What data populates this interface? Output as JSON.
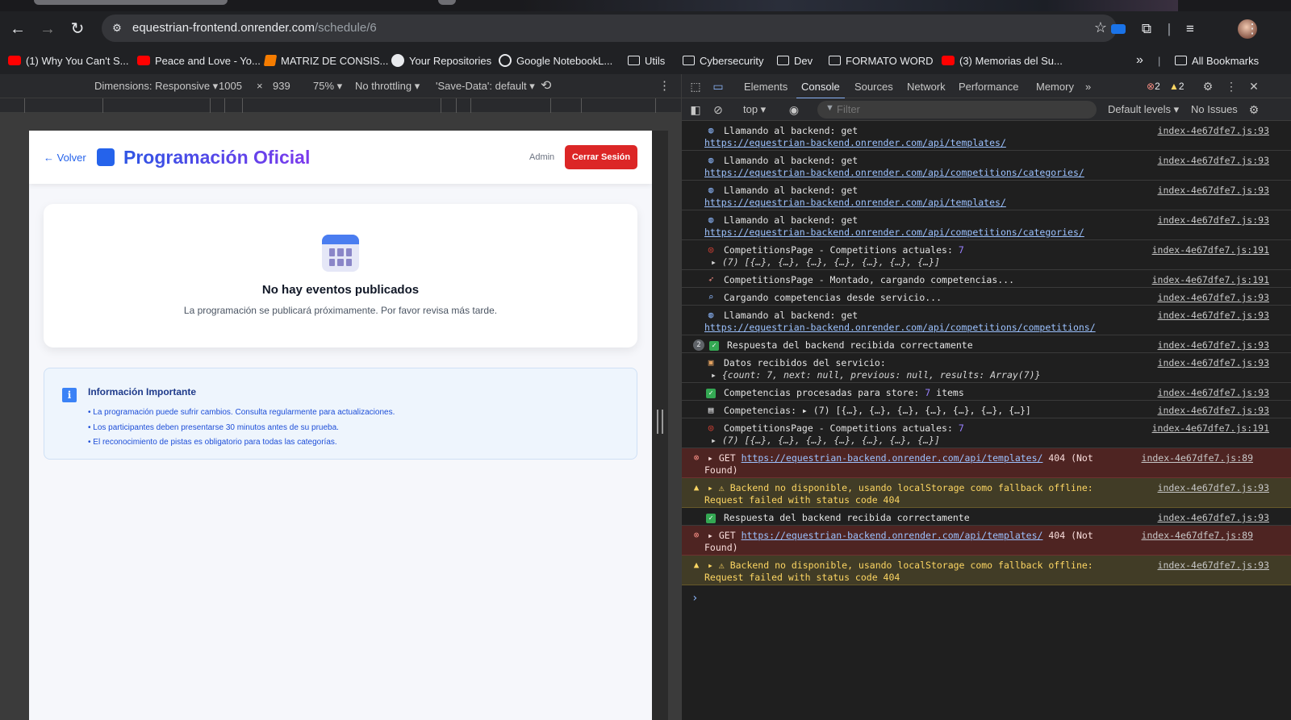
{
  "browser": {
    "url_host": "equestrian-frontend.onrender.com",
    "url_path": "/schedule/6",
    "bookmarks": [
      {
        "label": "(1) Why You Can't S...",
        "icon": "youtube-icon"
      },
      {
        "label": "Peace and Love - Yo...",
        "icon": "youtube-icon"
      },
      {
        "label": "MATRIZ DE CONSIS...",
        "icon": "matrix-icon"
      },
      {
        "label": "Your Repositories",
        "icon": "github-icon"
      },
      {
        "label": "Google NotebookL...",
        "icon": "notebook-icon"
      },
      {
        "label": "Utils",
        "icon": "folder-icon"
      },
      {
        "label": "Cybersecurity",
        "icon": "folder-icon"
      },
      {
        "label": "Dev",
        "icon": "folder-icon"
      },
      {
        "label": "FORMATO WORD",
        "icon": "folder-icon"
      },
      {
        "label": "(3) Memorias del Su...",
        "icon": "youtube-icon"
      }
    ],
    "overflow_label": "»",
    "all_bookmarks": "All Bookmarks"
  },
  "device_toolbar": {
    "dimensions": "Dimensions: Responsive ▾",
    "width": "1005",
    "times": "×",
    "height": "939",
    "zoom": "75% ▾",
    "throttling": "No throttling ▾",
    "save_data": "'Save-Data': default ▾"
  },
  "app": {
    "back": "← Volver",
    "title": "Programación Oficial",
    "user": "Admin",
    "logout": "Cerrar Sesión",
    "empty_title": "No hay eventos publicados",
    "empty_text": "La programación se publicará próximamente. Por favor revisa más tarde.",
    "info_title": "Información Importante",
    "info_items": [
      "• La programación puede sufrir cambios. Consulta regularmente para actualizaciones.",
      "• Los participantes deben presentarse 30 minutos antes de su prueba.",
      "• El reconocimiento de pistas es obligatorio para todas las categorías."
    ]
  },
  "devtools": {
    "tabs": [
      "Elements",
      "Console",
      "Sources",
      "Network",
      "Performance",
      "Memory"
    ],
    "more_tabs": "»",
    "error_count": "2",
    "warning_count": "2",
    "context": "top ▾",
    "filter_placeholder": "Filter",
    "levels": "Default levels ▾",
    "issues": "No Issues",
    "messages": [
      {
        "icon": "globe-icon",
        "text": "Llamando al backend: get",
        "link": "https://equestrian-backend.onrender.com/api/templates/",
        "src": "index-4e67dfe7.js:93"
      },
      {
        "icon": "globe-icon",
        "text": "Llamando al backend: get",
        "link": "https://equestrian-backend.onrender.com/api/competitions/categories/",
        "src": "index-4e67dfe7.js:93"
      },
      {
        "icon": "globe-icon",
        "text": "Llamando al backend: get",
        "link": "https://equestrian-backend.onrender.com/api/templates/",
        "src": "index-4e67dfe7.js:93"
      },
      {
        "icon": "globe-icon",
        "text": "Llamando al backend: get",
        "link": "https://equestrian-backend.onrender.com/api/competitions/categories/",
        "src": "index-4e67dfe7.js:93"
      },
      {
        "icon": "target-icon",
        "text": "CompetitionsPage - Competitions actuales:",
        "num": "7",
        "line2": "▸ (7) [{…}, {…}, {…}, {…}, {…}, {…}, {…}]",
        "src": "index-4e67dfe7.js:191"
      },
      {
        "icon": "rocket-icon",
        "text": "CompetitionsPage - Montado, cargando competencias...",
        "src": "index-4e67dfe7.js:191"
      },
      {
        "icon": "magnifier-icon",
        "text": "Cargando competencias desde servicio...",
        "src": "index-4e67dfe7.js:93"
      },
      {
        "icon": "globe-icon",
        "text": "Llamando al backend: get",
        "link": "https://equestrian-backend.onrender.com/api/competitions/competitions/",
        "src": "index-4e67dfe7.js:93"
      },
      {
        "icon": "check-icon",
        "repeat": "2",
        "text": "Respuesta del backend recibida correctamente",
        "src": "index-4e67dfe7.js:93"
      },
      {
        "icon": "package-icon",
        "text": "Datos recibidos del servicio:",
        "line2": "▸ {count: 7, next: null, previous: null, results: Array(7)}",
        "src": "index-4e67dfe7.js:93"
      },
      {
        "icon": "check-icon",
        "text": "Competencias procesadas para store:",
        "num": "7",
        "tail": "items",
        "src": "index-4e67dfe7.js:93"
      },
      {
        "icon": "clipboard-icon",
        "text": "Competencias:  ▸ (7) [{…}, {…}, {…}, {…}, {…}, {…}, {…}]",
        "src": "index-4e67dfe7.js:93"
      },
      {
        "icon": "target-icon",
        "text": "CompetitionsPage - Competitions actuales:",
        "num": "7",
        "line2": "▸ (7) [{…}, {…}, {…}, {…}, {…}, {…}, {…}]",
        "src": "index-4e67dfe7.js:191"
      },
      {
        "type": "error",
        "icon": "error-icon",
        "prefix": "▸ GET",
        "link": "https://equestrian-backend.onrender.com/api/templates/",
        "tail": "404 (Not",
        "line2": "Found)",
        "src": "index-4e67dfe7.js:89"
      },
      {
        "type": "warning",
        "icon": "warning-icon",
        "text": "▸ ⚠ Backend no disponible, usando localStorage como fallback offline:",
        "line2": "Request failed with status code 404",
        "src": "index-4e67dfe7.js:93"
      },
      {
        "icon": "check-icon",
        "text": "Respuesta del backend recibida correctamente",
        "src": "index-4e67dfe7.js:93"
      },
      {
        "type": "error",
        "icon": "error-icon",
        "prefix": "▸ GET",
        "link": "https://equestrian-backend.onrender.com/api/templates/",
        "tail": "404 (Not",
        "line2": "Found)",
        "src": "index-4e67dfe7.js:89"
      },
      {
        "type": "warning",
        "icon": "warning-icon",
        "text": "▸ ⚠ Backend no disponible, usando localStorage como fallback offline:",
        "line2": "Request failed with status code 404",
        "src": "index-4e67dfe7.js:93"
      }
    ],
    "prompt": "›"
  }
}
